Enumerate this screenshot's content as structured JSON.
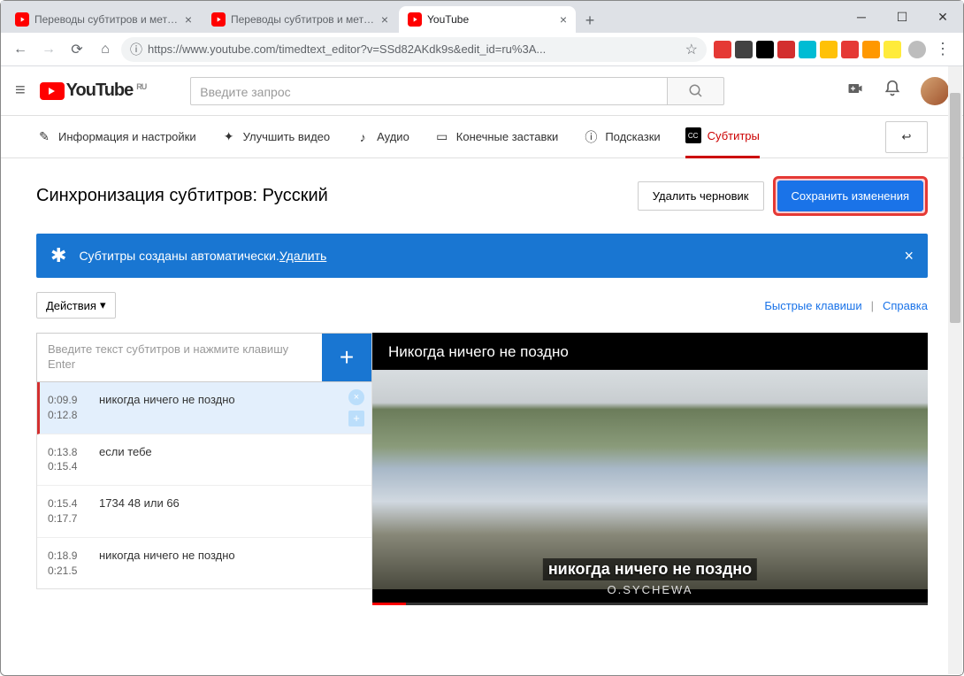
{
  "browser": {
    "tabs": [
      {
        "title": "Переводы субтитров и метадан"
      },
      {
        "title": "Переводы субтитров и метадан"
      },
      {
        "title": "YouTube"
      }
    ],
    "url": "https://www.youtube.com/timedtext_editor?v=SSd82AKdk9s&edit_id=ru%3A..."
  },
  "header": {
    "logo": "YouTube",
    "region": "RU",
    "search_placeholder": "Введите запрос"
  },
  "editTabs": {
    "info": "Информация и настройки",
    "enhance": "Улучшить видео",
    "audio": "Аудио",
    "endscreens": "Конечные заставки",
    "cards": "Подсказки",
    "subtitles": "Субтитры"
  },
  "page": {
    "title": "Синхронизация субтитров: Русский",
    "delete_draft": "Удалить черновик",
    "save": "Сохранить изменения"
  },
  "banner": {
    "text": "Субтитры созданы автоматически. ",
    "link": "Удалить"
  },
  "actions": {
    "dropdown": "Действия",
    "shortcuts": "Быстрые клавиши",
    "help": "Справка"
  },
  "input": {
    "placeholder": "Введите текст субтитров и нажмите клавишу Enter"
  },
  "subs": [
    {
      "start": "0:09.9",
      "end": "0:12.8",
      "text": "никогда ничего не поздно",
      "active": true
    },
    {
      "start": "0:13.8",
      "end": "0:15.4",
      "text": "если тебе"
    },
    {
      "start": "0:15.4",
      "end": "0:17.7",
      "text": "1734 48 или 66"
    },
    {
      "start": "0:18.9",
      "end": "0:21.5",
      "text": "никогда ничего не поздно"
    }
  ],
  "video": {
    "title": "Никогда ничего не поздно",
    "caption": "никогда ничего не поздно",
    "author": "O.SYCHEWA"
  }
}
